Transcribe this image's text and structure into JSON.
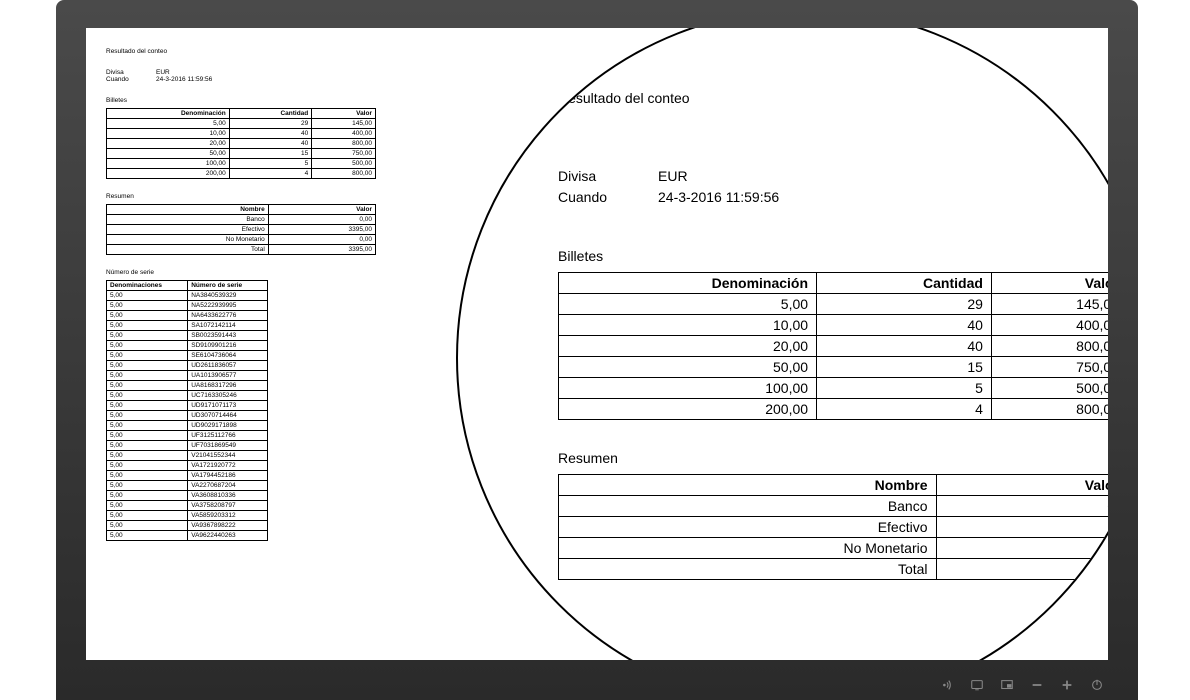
{
  "report": {
    "title": "Resultado del conteo",
    "meta": {
      "currency_label": "Divisa",
      "currency_value": "EUR",
      "when_label": "Cuando",
      "when_value": "24-3-2016 11:59:56"
    },
    "bills": {
      "section_title": "Billetes",
      "headers": {
        "denom": "Denominación",
        "qty": "Cantidad",
        "value": "Valor"
      },
      "rows": [
        {
          "denom": "5,00",
          "qty": "29",
          "value": "145,00"
        },
        {
          "denom": "10,00",
          "qty": "40",
          "value": "400,00"
        },
        {
          "denom": "20,00",
          "qty": "40",
          "value": "800,00"
        },
        {
          "denom": "50,00",
          "qty": "15",
          "value": "750,00"
        },
        {
          "denom": "100,00",
          "qty": "5",
          "value": "500,00"
        },
        {
          "denom": "200,00",
          "qty": "4",
          "value": "800,00"
        }
      ]
    },
    "summary": {
      "section_title": "Resumen",
      "headers": {
        "name": "Nombre",
        "value": "Valor"
      },
      "rows": [
        {
          "name": "Banco",
          "value": "0,00"
        },
        {
          "name": "Efectivo",
          "value": "3395,00"
        },
        {
          "name": "No Monetario",
          "value": "0,00"
        },
        {
          "name": "Total",
          "value": "3395,00"
        }
      ]
    },
    "serials": {
      "section_title": "Número de serie",
      "headers": {
        "denom": "Denominaciones",
        "serial": "Número de serie"
      },
      "rows": [
        {
          "denom": "5,00",
          "serial": "NA3840539329"
        },
        {
          "denom": "5,00",
          "serial": "NA5222939995"
        },
        {
          "denom": "5,00",
          "serial": "NA6433622776"
        },
        {
          "denom": "5,00",
          "serial": "SA1072142114"
        },
        {
          "denom": "5,00",
          "serial": "SB0023591443"
        },
        {
          "denom": "5,00",
          "serial": "SD9109901216"
        },
        {
          "denom": "5,00",
          "serial": "SE6104736064"
        },
        {
          "denom": "5,00",
          "serial": "UD2611836057"
        },
        {
          "denom": "5,00",
          "serial": "UA1013906577"
        },
        {
          "denom": "5,00",
          "serial": "UA8168317296"
        },
        {
          "denom": "5,00",
          "serial": "UC7163305246"
        },
        {
          "denom": "5,00",
          "serial": "UD9171071173"
        },
        {
          "denom": "5,00",
          "serial": "UD3070714464"
        },
        {
          "denom": "5,00",
          "serial": "UD9029171898"
        },
        {
          "denom": "5,00",
          "serial": "UF3125112766"
        },
        {
          "denom": "5,00",
          "serial": "UF7031869549"
        },
        {
          "denom": "5,00",
          "serial": "V21041552344"
        },
        {
          "denom": "5,00",
          "serial": "VA1721920772"
        },
        {
          "denom": "5,00",
          "serial": "VA1794452186"
        },
        {
          "denom": "5,00",
          "serial": "VA2270687204"
        },
        {
          "denom": "5,00",
          "serial": "VA3608810336"
        },
        {
          "denom": "5,00",
          "serial": "VA3758208797"
        },
        {
          "denom": "5,00",
          "serial": "VA5859203312"
        },
        {
          "denom": "5,00",
          "serial": "VA9367898222"
        },
        {
          "denom": "5,00",
          "serial": "VA9622440263"
        }
      ]
    }
  },
  "magnified_summary_values": {
    "banco": "0,",
    "efectivo": "3",
    "no_monetario": "",
    "total": ""
  }
}
